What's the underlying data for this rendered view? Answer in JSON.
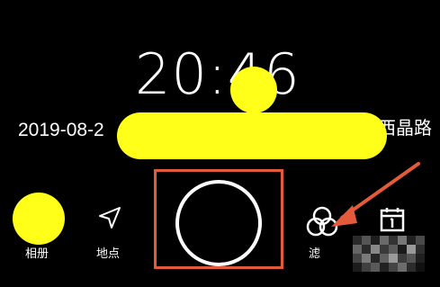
{
  "clock": {
    "time": "20:46"
  },
  "info": {
    "date": "2019-08-2",
    "location": "西晶路"
  },
  "bottom_bar": {
    "album_label": "相册",
    "location_label": "地点",
    "filter_label": "滤"
  },
  "colors": {
    "background": "#000000",
    "redaction": "#ffff1a",
    "highlight_box": "#e35b3a",
    "annotation_arrow": "#e35b3a",
    "foreground": "#ffffff"
  },
  "icons": {
    "album": "album-thumbnail",
    "location": "navigation-arrow-icon",
    "shutter": "shutter-icon",
    "filter": "filter-overlap-circles-icon",
    "calendar": "calendar-icon"
  }
}
